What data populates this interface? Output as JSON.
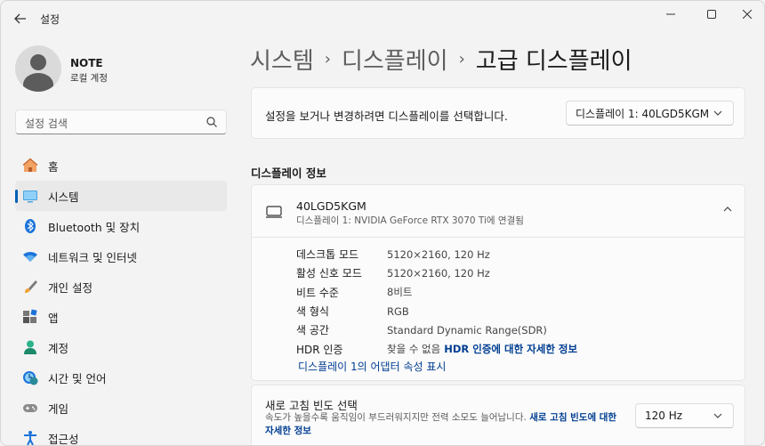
{
  "window": {
    "title": "설정"
  },
  "profile": {
    "name": "NOTE",
    "account_type": "로컬 계정"
  },
  "search": {
    "placeholder": "설정 검색"
  },
  "nav": {
    "items": [
      {
        "label": "홈",
        "icon": "home-icon"
      },
      {
        "label": "시스템",
        "icon": "system-icon",
        "selected": true
      },
      {
        "label": "Bluetooth 및 장치",
        "icon": "bluetooth-icon"
      },
      {
        "label": "네트워크 및 인터넷",
        "icon": "network-icon"
      },
      {
        "label": "개인 설정",
        "icon": "personalization-icon"
      },
      {
        "label": "앱",
        "icon": "apps-icon"
      },
      {
        "label": "계정",
        "icon": "accounts-icon"
      },
      {
        "label": "시간 및 언어",
        "icon": "time-language-icon"
      },
      {
        "label": "게임",
        "icon": "gaming-icon"
      },
      {
        "label": "접근성",
        "icon": "accessibility-icon"
      }
    ]
  },
  "breadcrumb": {
    "part1": "시스템",
    "part2": "디스플레이",
    "current": "고급 디스플레이"
  },
  "display_select": {
    "text": "설정을 보거나 변경하려면 디스플레이를 선택합니다.",
    "selected": "디스플레이 1: 40LGD5KGM"
  },
  "display_info": {
    "section_title": "디스플레이 정보",
    "monitor_name": "40LGD5KGM",
    "monitor_sub": "디스플레이 1: NVIDIA GeForce RTX 3070 Ti에 연결됨",
    "rows": [
      {
        "key": "데스크톱 모드",
        "value": "5120×2160, 120 Hz"
      },
      {
        "key": "활성 신호 모드",
        "value": "5120×2160, 120 Hz"
      },
      {
        "key": "비트 수준",
        "value": "8비트"
      },
      {
        "key": "색 형식",
        "value": "RGB"
      },
      {
        "key": "색 공간",
        "value": "Standard Dynamic Range(SDR)"
      },
      {
        "key": "HDR 인증",
        "value": "찾을 수 없음",
        "link": "HDR 인증에 대한 자세한 정보"
      }
    ],
    "adapter_link": "디스플레이 1의 어댑터 속성 표시"
  },
  "refresh_rate": {
    "title": "새로 고침 빈도 선택",
    "desc": "속도가 높을수록 움직임이 부드러워지지만 전력 소모도 늘어납니다.",
    "link": "새로 고침 빈도에 대한 자세한 정보",
    "selected": "120 Hz"
  },
  "colors": {
    "accent": "#005fb8",
    "link": "#003e92"
  }
}
